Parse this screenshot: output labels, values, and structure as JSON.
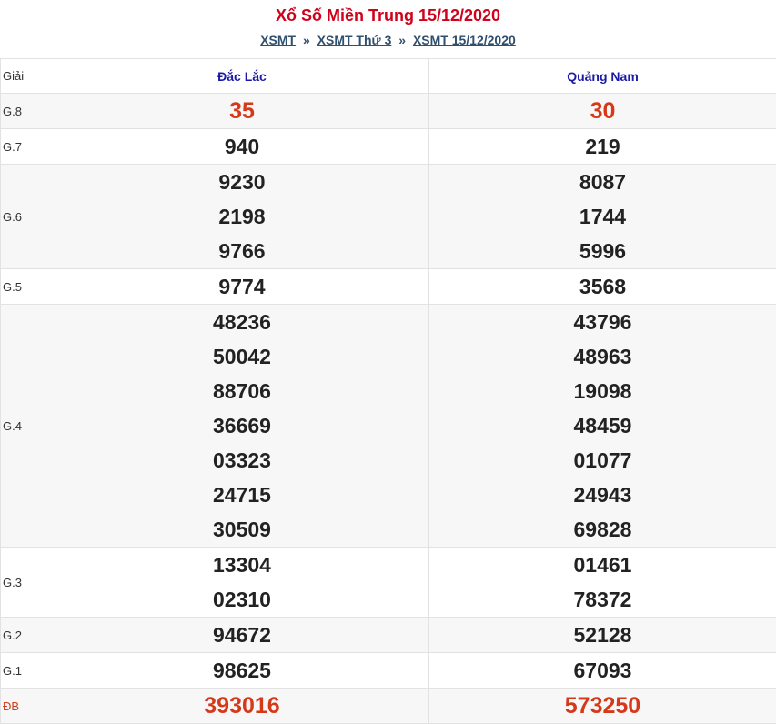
{
  "header": {
    "title": "Xổ Số Miền Trung 15/12/2020",
    "breadcrumb": [
      {
        "label": "XSMT"
      },
      {
        "label": "XSMT Thứ 3"
      },
      {
        "label": "XSMT 15/12/2020"
      }
    ],
    "separator": "»"
  },
  "table": {
    "col_label": "Giải",
    "provinces": [
      "Đắc Lắc",
      "Quảng Nam"
    ],
    "rows": [
      {
        "label": "G.8",
        "a": [
          "35"
        ],
        "b": [
          "30"
        ]
      },
      {
        "label": "G.7",
        "a": [
          "940"
        ],
        "b": [
          "219"
        ]
      },
      {
        "label": "G.6",
        "a": [
          "9230",
          "2198",
          "9766"
        ],
        "b": [
          "8087",
          "1744",
          "5996"
        ]
      },
      {
        "label": "G.5",
        "a": [
          "9774"
        ],
        "b": [
          "3568"
        ]
      },
      {
        "label": "G.4",
        "a": [
          "48236",
          "50042",
          "88706",
          "36669",
          "03323",
          "24715",
          "30509"
        ],
        "b": [
          "43796",
          "48963",
          "19098",
          "48459",
          "01077",
          "24943",
          "69828"
        ]
      },
      {
        "label": "G.3",
        "a": [
          "13304",
          "02310"
        ],
        "b": [
          "01461",
          "78372"
        ]
      },
      {
        "label": "G.2",
        "a": [
          "94672"
        ],
        "b": [
          "52128"
        ]
      },
      {
        "label": "G.1",
        "a": [
          "98625"
        ],
        "b": [
          "67093"
        ]
      },
      {
        "label": "ĐB",
        "a": [
          "393016"
        ],
        "b": [
          "573250"
        ]
      }
    ]
  },
  "colors": {
    "title": "#d0021b",
    "highlight": "#d6391a",
    "province": "#1a1aa6"
  }
}
